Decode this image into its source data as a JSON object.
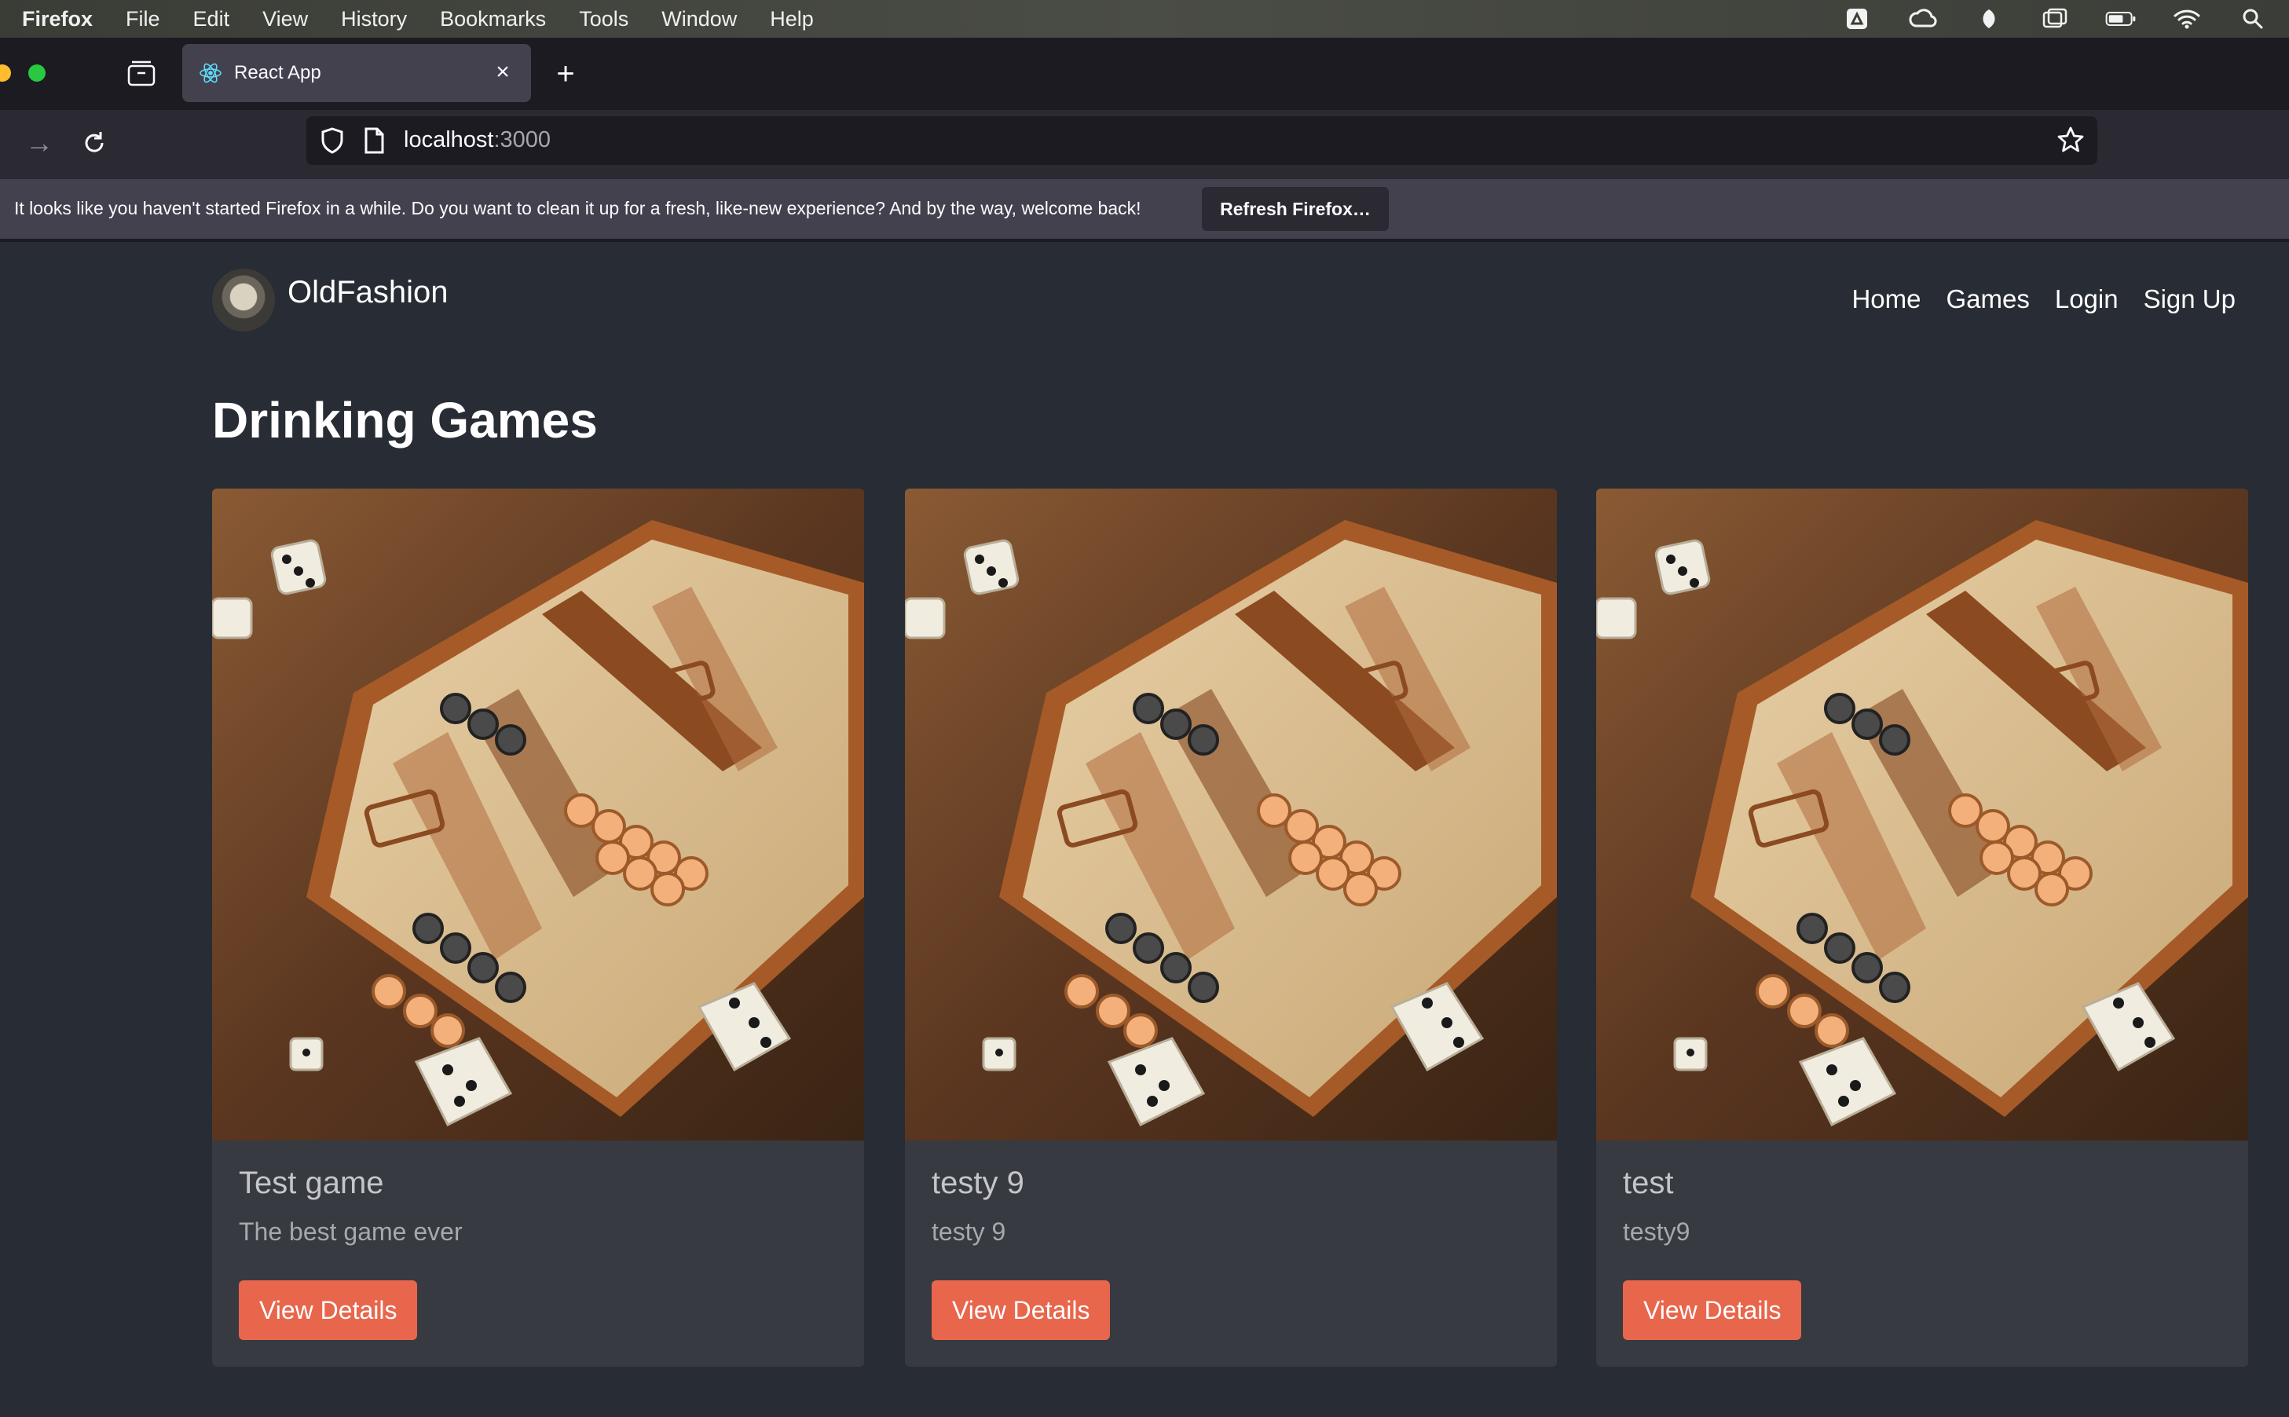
{
  "menubar": {
    "app": "Firefox",
    "items": [
      "File",
      "Edit",
      "View",
      "History",
      "Bookmarks",
      "Tools",
      "Window",
      "Help"
    ],
    "status_icons": [
      "drive-icon",
      "creative-cloud-icon",
      "leaf-icon",
      "window-icon",
      "battery-icon",
      "wifi-icon",
      "search-icon"
    ]
  },
  "browser": {
    "tab_title": "React App",
    "url_host": "localhost",
    "url_port": ":3000"
  },
  "notification": {
    "message": "It looks like you haven't started Firefox in a while. Do you want to clean it up for a fresh, like-new experience? And by the way, welcome back!",
    "button": "Refresh Firefox…"
  },
  "site": {
    "brand": "OldFashion",
    "nav": [
      "Home",
      "Games",
      "Login",
      "Sign Up"
    ],
    "page_title": "Drinking Games",
    "cards": [
      {
        "name": "Test game",
        "description": "The best game ever",
        "button": "View Details"
      },
      {
        "name": "testy 9",
        "description": "testy 9",
        "button": "View Details"
      },
      {
        "name": "test",
        "description": "testy9",
        "button": "View Details"
      }
    ]
  },
  "colors": {
    "page_bg": "#282c34",
    "card_bg": "#373a41",
    "button": "#e8664c"
  }
}
